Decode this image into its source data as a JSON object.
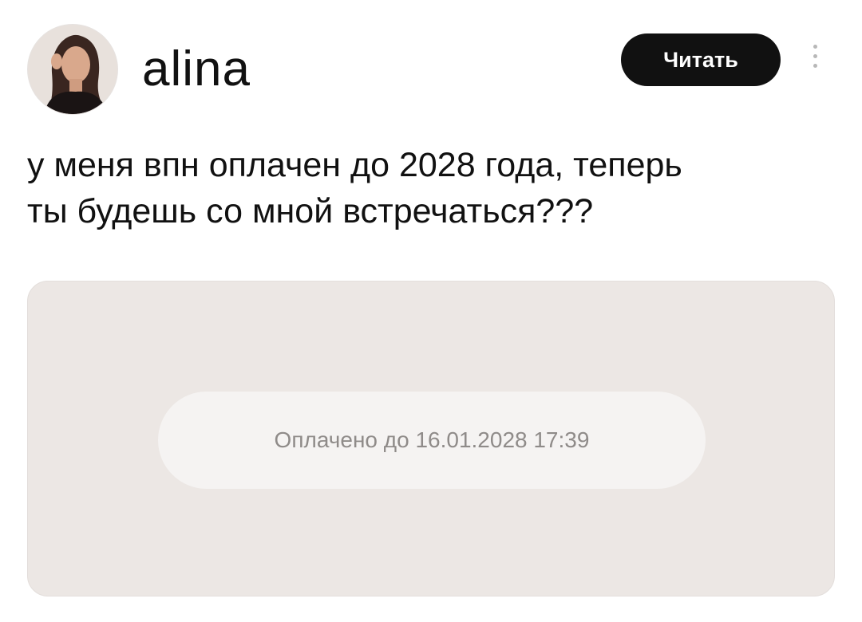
{
  "author": {
    "username": "alina",
    "avatar_icon": "profile-photo"
  },
  "actions": {
    "follow_label": "Читать",
    "more_icon": "vertical-ellipsis-icon"
  },
  "post": {
    "text": "у меня впн оплачен до 2028 года, теперь\nты будешь со мной встречаться???"
  },
  "attachment": {
    "status_text": "Оплачено до 16.01.2028 17:39"
  },
  "colors": {
    "button_bg": "#111111",
    "button_text": "#ffffff",
    "card_bg": "#ece7e4",
    "pill_bg": "#f5f3f2",
    "muted_text": "#8f8b89"
  }
}
